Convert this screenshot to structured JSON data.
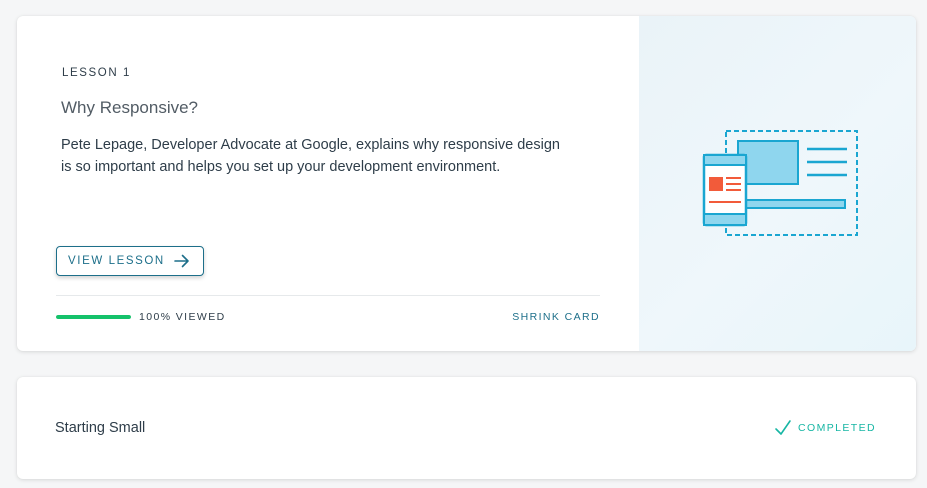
{
  "lesson_card": {
    "label": "LESSON 1",
    "title": "Why Responsive?",
    "description": "Pete Lepage, Developer Advocate at Google, explains why responsive design is so important and helps you set up your development environment.",
    "view_button_label": "VIEW LESSON",
    "view_button_icon": "arrow-right-icon",
    "progress_fraction": 1.0,
    "progress_text": "100% VIEWED",
    "shrink_label": "SHRINK CARD",
    "illustration_icon": "responsive-devices-illustration"
  },
  "next_card": {
    "title": "Starting Small",
    "status_label": "COMPLETED",
    "status_icon": "check-icon"
  },
  "colors": {
    "accent": "#1d6f8a",
    "progress": "#15c26b",
    "completed": "#17b6a4",
    "illustration_stroke": "#1aa6d1",
    "illustration_fill": "#8fd6ee",
    "illustration_red": "#f25b3a"
  }
}
